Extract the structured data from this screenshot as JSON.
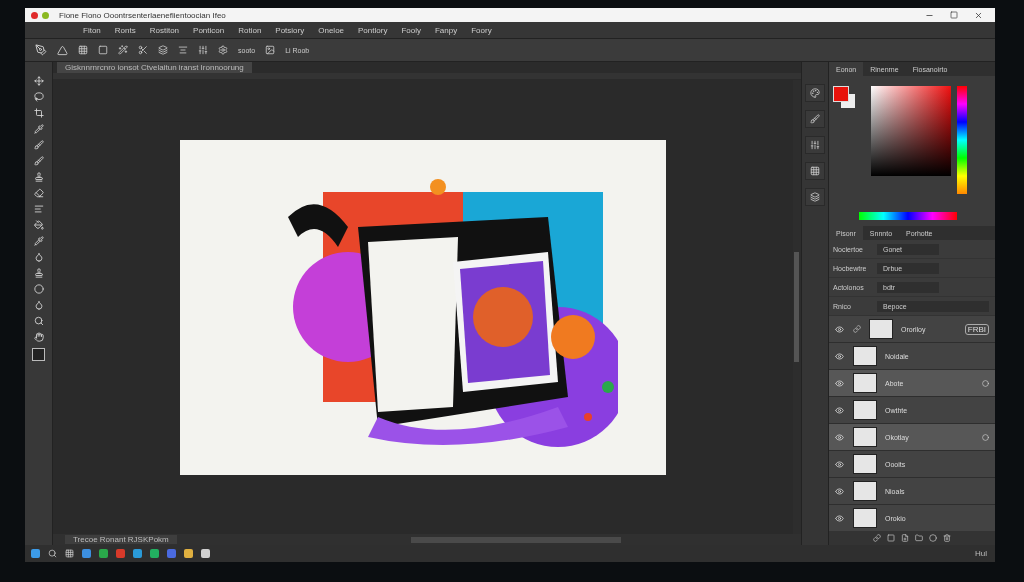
{
  "window": {
    "title": "Fione Flono Ooontrsenterlaeneflientoocian Ifeo"
  },
  "menu": [
    "Fiton",
    "Ronts",
    "Rostiton",
    "Ponticon",
    "Rotion",
    "Potsiory",
    "Oneloe",
    "Pontlory",
    "Fooly",
    "Fanpy",
    "Foory"
  ],
  "options_bar": {
    "texts": [
      "sooto",
      "Li Roob"
    ]
  },
  "document": {
    "tab": "Gisknnrnrcnro ionsot Ctvelaitun iranst Ironnoorung",
    "status": "Trecoe Ronant RJSKPokm"
  },
  "color_panel": {
    "tabs": [
      {
        "label": "Eonon",
        "selected": true
      },
      {
        "label": "Rinenrne",
        "selected": false
      },
      {
        "label": "Fiosanoirto",
        "selected": false
      }
    ]
  },
  "properties_panel": {
    "tabs": [
      {
        "label": "Pisonr",
        "selected": true
      },
      {
        "label": "Snnnto",
        "selected": false
      },
      {
        "label": "Porhotte",
        "selected": false
      }
    ],
    "rows": [
      {
        "label": "Nociertoe",
        "value": "Gonet"
      },
      {
        "label": "Hocbewtre",
        "value": "Drbue"
      },
      {
        "label": "Actolonos",
        "value": "bdtr"
      },
      {
        "label": "Rnico",
        "value": "Bepoce"
      }
    ]
  },
  "layers": [
    {
      "name": "Ororiloy",
      "visible": true,
      "selected": false,
      "badge": "FRBI",
      "linked": true
    },
    {
      "name": "Noidale",
      "visible": true,
      "selected": false
    },
    {
      "name": "Abote",
      "visible": true,
      "selected": true
    },
    {
      "name": "Owthte",
      "visible": true,
      "selected": false
    },
    {
      "name": "Okotlay",
      "visible": true,
      "selected": true
    },
    {
      "name": "Oooits",
      "visible": true,
      "selected": false
    },
    {
      "name": "Nioals",
      "visible": true,
      "selected": false
    },
    {
      "name": "Orokio",
      "visible": true,
      "selected": false
    }
  ],
  "status_right": "Hul"
}
